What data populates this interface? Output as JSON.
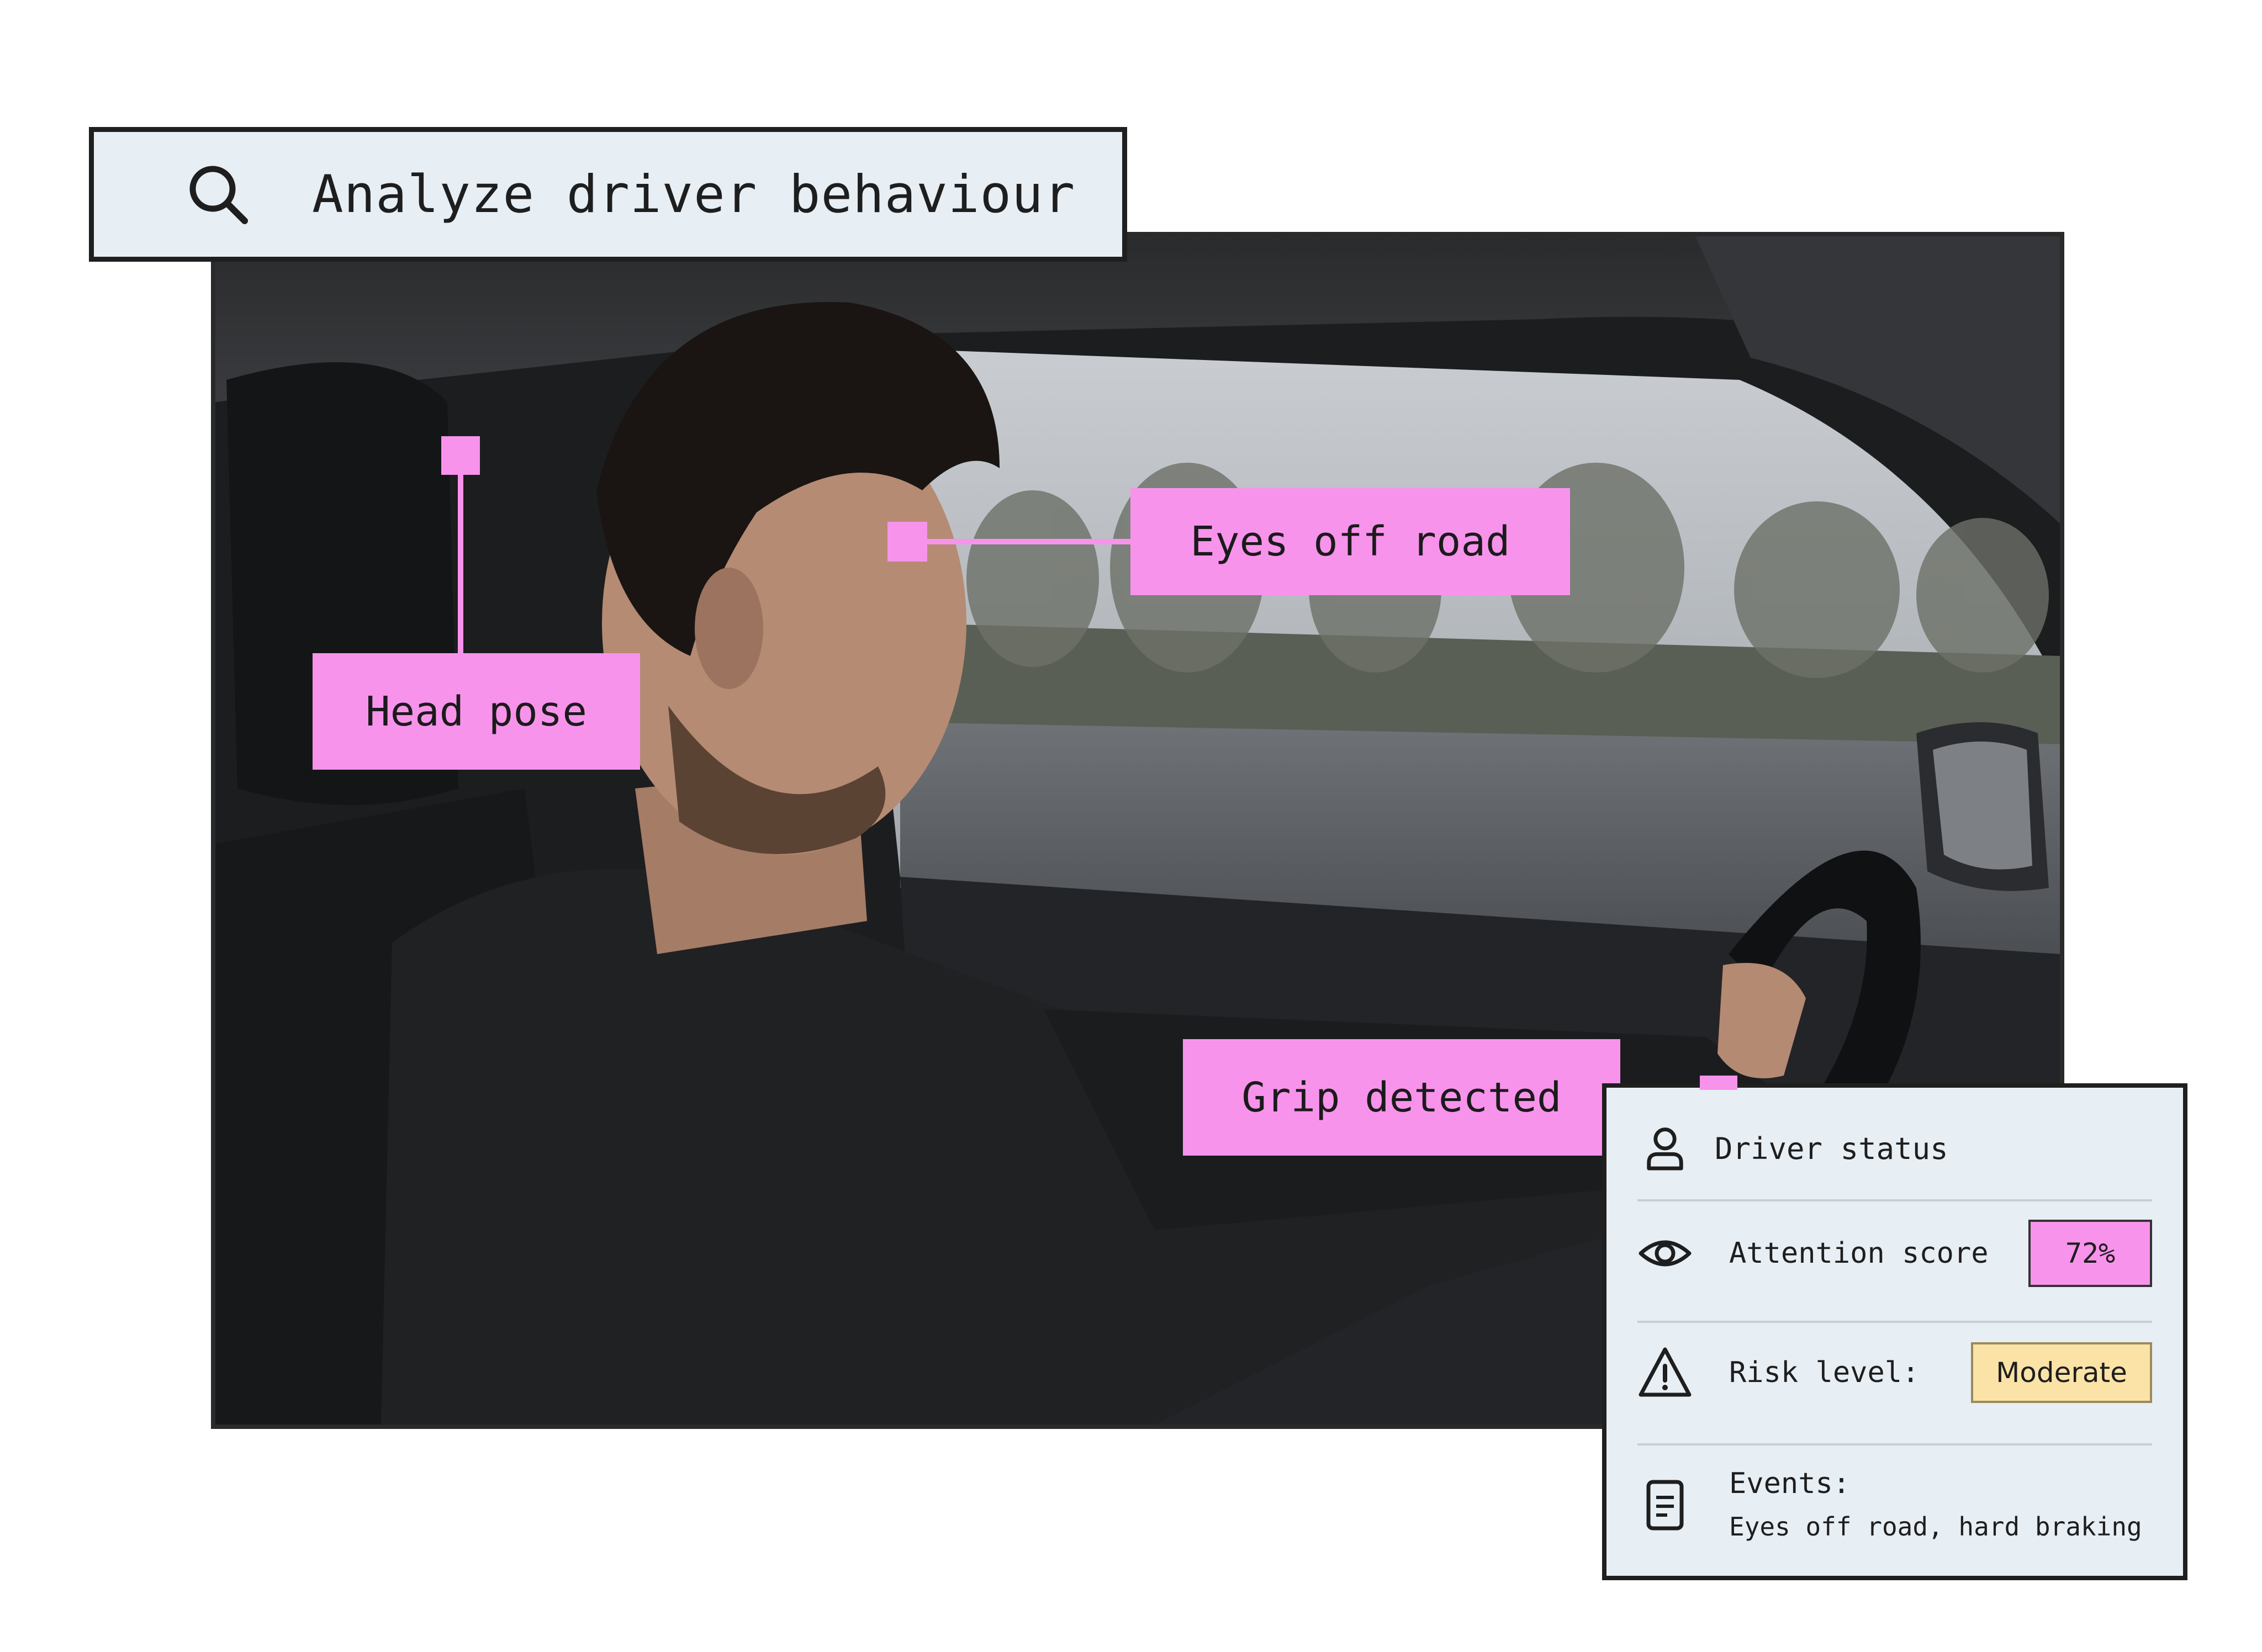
{
  "search": {
    "icon": "search-icon",
    "query": "Analyze driver behaviour"
  },
  "annotations": {
    "head_pose": "Head pose",
    "eyes_off_road": "Eyes off road",
    "grip_detected": "Grip detected"
  },
  "status_panel": {
    "title": "Driver status",
    "title_icon": "user-icon",
    "attention": {
      "icon": "eye-icon",
      "label": "Attention score",
      "value": "72%"
    },
    "risk": {
      "icon": "warning-icon",
      "label": "Risk level:",
      "value": "Moderate"
    },
    "events": {
      "icon": "document-icon",
      "label": "Events:",
      "value": "Eyes off road, hard braking"
    }
  },
  "colors": {
    "annotation": "#f893ec",
    "panel_bg": "#e7eef4",
    "risk_badge": "#fbe3a7",
    "border": "#1f1f1f"
  }
}
